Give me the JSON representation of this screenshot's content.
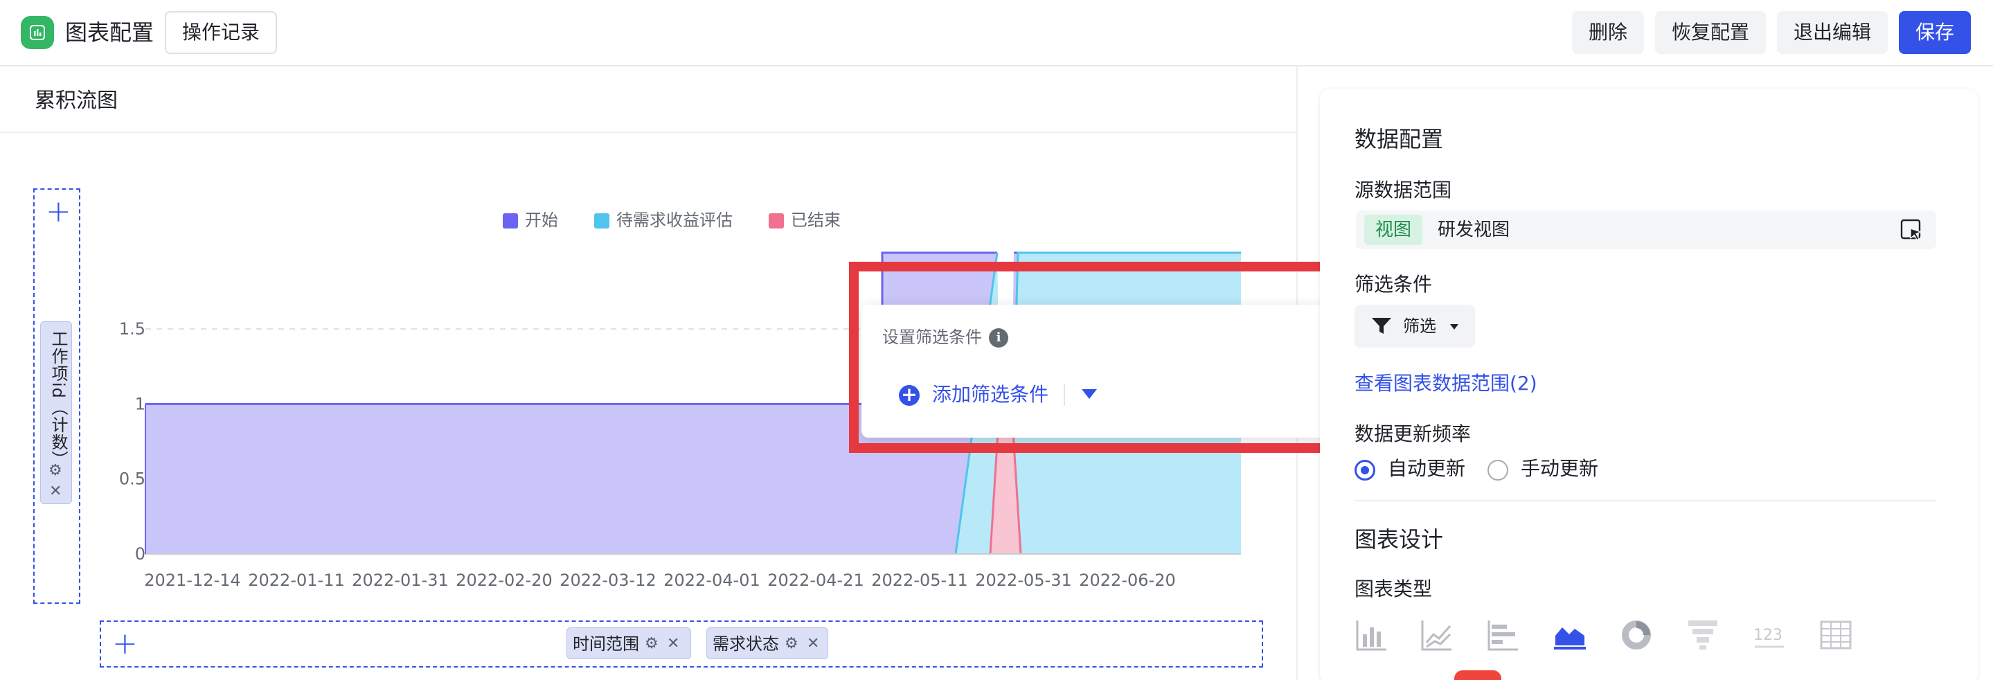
{
  "header": {
    "title": "图表配置",
    "history_label": "操作记录",
    "delete_label": "删除",
    "restore_label": "恢复配置",
    "exit_label": "退出编辑",
    "save_label": "保存"
  },
  "chart_panel": {
    "chart_title": "累积流图",
    "y_field_label": "工作项id（计数）",
    "x_fields": [
      "时间范围",
      "需求状态"
    ]
  },
  "chart_data": {
    "type": "area",
    "legend": [
      {
        "name": "开始",
        "color": "#6c63f0",
        "fill": "#c9c5f8"
      },
      {
        "name": "待需求收益评估",
        "color": "#4fc4ee",
        "fill": "#b8e9f9"
      },
      {
        "name": "已结束",
        "color": "#f07090",
        "fill": "#f9c5d2"
      }
    ],
    "x_ticks": [
      "2021-12-14",
      "2022-01-11",
      "2022-01-31",
      "2022-02-20",
      "2022-03-12",
      "2022-04-01",
      "2022-04-21",
      "2022-05-11",
      "2022-05-31",
      "2022-06-20"
    ],
    "y_ticks": [
      "0",
      "0.5",
      "1",
      "1.5"
    ],
    "ylim": [
      0,
      1.5
    ],
    "grid": true,
    "legend_position": "top"
  },
  "filter_popup": {
    "title": "设置筛选条件",
    "add_label": "添加筛选条件"
  },
  "data_config": {
    "heading": "数据配置",
    "source_label": "源数据范围",
    "source_tag": "视图",
    "source_name": "研发视图",
    "filter_heading": "筛选条件",
    "filter_button": "筛选",
    "range_link": "查看图表数据范围(2)",
    "update_heading": "数据更新频率",
    "auto_update": "自动更新",
    "manual_update": "手动更新",
    "auto_selected": true
  },
  "chart_design": {
    "heading": "图表设计",
    "type_label": "图表类型",
    "types": [
      "bar-chart-icon",
      "line-chart-icon",
      "horizontal-bar-icon",
      "area-chart-icon",
      "donut-chart-icon",
      "funnel-chart-icon",
      "number-chart-icon",
      "table-chart-icon"
    ],
    "selected_type": "area-chart-icon",
    "accent": "#3451e8"
  }
}
